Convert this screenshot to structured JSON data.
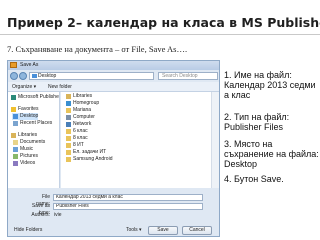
{
  "slide": {
    "title": "Пример 2– календар на класа в MS Publisher",
    "subtitle": "7. Съхраняване на документа – от File, Save As…."
  },
  "dialog": {
    "title": "Save As",
    "address": "Desktop",
    "search_placeholder": "Search Desktop",
    "toolbar": {
      "organize": "Organize ▾",
      "new_folder": "New folder"
    },
    "nav_items": [
      {
        "label": "Microsoft Publishe",
        "icon": "publisher-icon"
      },
      {
        "label": "Favorites",
        "icon": "star-icon"
      },
      {
        "label": "Desktop",
        "icon": "desktop-icon",
        "selected": true
      },
      {
        "label": "Recent Places",
        "icon": "recent-places-icon"
      },
      {
        "label": "Libraries",
        "icon": "library-icon"
      },
      {
        "label": "Documents",
        "icon": "document-icon"
      },
      {
        "label": "Music",
        "icon": "music-icon"
      },
      {
        "label": "Pictures",
        "icon": "picture-icon"
      },
      {
        "label": "Videos",
        "icon": "video-icon"
      }
    ],
    "files": [
      {
        "label": "Libraries",
        "icon": "library-icon"
      },
      {
        "label": "Homegroup",
        "icon": "homegroup-icon"
      },
      {
        "label": "Mariana",
        "icon": "user-folder-icon"
      },
      {
        "label": "Computer",
        "icon": "computer-icon"
      },
      {
        "label": "Network",
        "icon": "network-icon"
      },
      {
        "label": "6 клас",
        "icon": "folder-icon"
      },
      {
        "label": "8 клас",
        "icon": "folder-icon"
      },
      {
        "label": "8 ИТ",
        "icon": "folder-icon"
      },
      {
        "label": "Ел. задачи ИТ",
        "icon": "folder-icon"
      },
      {
        "label": "Samsung Android",
        "icon": "folder-icon"
      }
    ],
    "file_name_label": "File name:",
    "file_name_value": "Календар 2013 седми а клас",
    "save_type_label": "Save as type:",
    "save_type_value": "Publisher Files",
    "authors_label": "Authors:",
    "authors_value": "ivie",
    "hide_folders": "Hide Folders",
    "tools_label": "Tools ▾",
    "save_button": "Save",
    "cancel_button": "Cancel",
    "colors": {
      "folder": "#e9c45a",
      "selection": "#cde4fb",
      "chrome": "#dfe8f3"
    }
  },
  "annotations": [
    "1.  Име на файл: Календар 2013 седми а клас",
    "2. Тип на файл: Publisher Files",
    "3. Място на съхранение на файла: Desktop",
    "4. Бутон Save."
  ]
}
